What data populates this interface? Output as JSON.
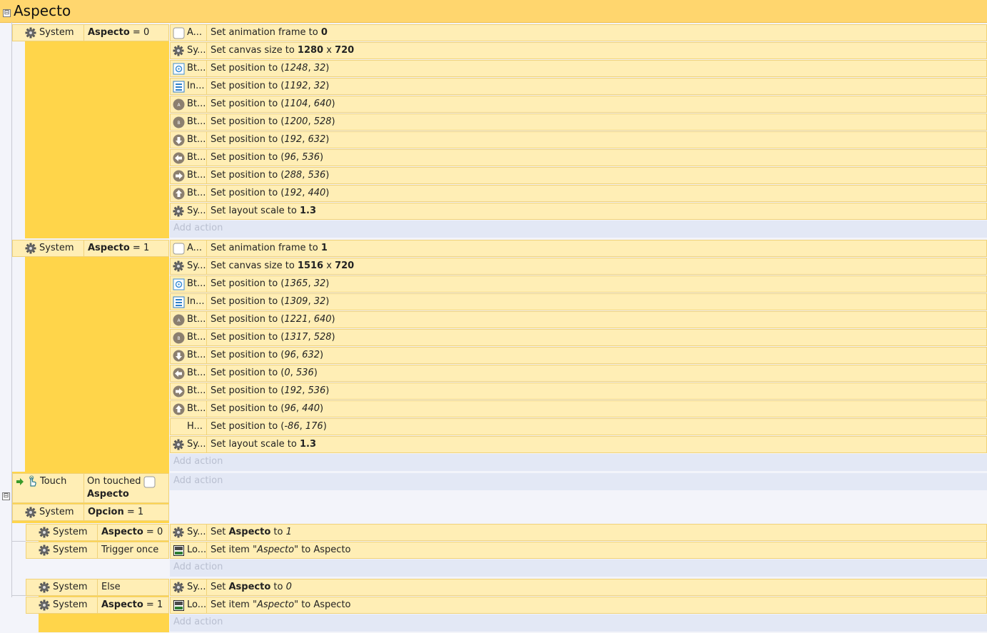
{
  "group": {
    "title": "Aspecto",
    "collapse_symbol": "⊟"
  },
  "add_action_label": "Add action",
  "events": [
    {
      "conditions": [
        {
          "object": "System",
          "icon": "gear-icon",
          "text_bold": "Aspecto",
          "text_rest": " = 0"
        }
      ],
      "actions": [
        {
          "icon": "checkbox-sprite-icon",
          "obj": "A...",
          "parts": [
            "Set animation frame to ",
            "0"
          ],
          "fmt": [
            "",
            "b"
          ]
        },
        {
          "icon": "gear-icon",
          "obj": "Sy...",
          "parts": [
            "Set canvas size to ",
            "1280",
            " x ",
            "720"
          ],
          "fmt": [
            "",
            "b",
            "",
            "b"
          ]
        },
        {
          "icon": "settings-button-icon",
          "obj": "Bt...",
          "parts": [
            "Set position to (",
            "1248",
            ", ",
            "32",
            ")"
          ],
          "fmt": [
            "",
            "i",
            "",
            "i",
            ""
          ]
        },
        {
          "icon": "list-icon",
          "obj": "In...",
          "parts": [
            "Set position to (",
            "1192",
            ", ",
            "32",
            ")"
          ],
          "fmt": [
            "",
            "i",
            "",
            "i",
            ""
          ]
        },
        {
          "icon": "button-a-icon",
          "obj": "Bt...",
          "parts": [
            "Set position to (",
            "1104",
            ", ",
            "640",
            ")"
          ],
          "fmt": [
            "",
            "i",
            "",
            "i",
            ""
          ]
        },
        {
          "icon": "button-b-icon",
          "obj": "Bt...",
          "parts": [
            "Set position to (",
            "1200",
            ", ",
            "528",
            ")"
          ],
          "fmt": [
            "",
            "i",
            "",
            "i",
            ""
          ]
        },
        {
          "icon": "arrow-down-icon",
          "obj": "Bt...",
          "parts": [
            "Set position to (",
            "192",
            ", ",
            "632",
            ")"
          ],
          "fmt": [
            "",
            "i",
            "",
            "i",
            ""
          ]
        },
        {
          "icon": "arrow-left-icon",
          "obj": "Bt...",
          "parts": [
            "Set position to (",
            "96",
            ", ",
            "536",
            ")"
          ],
          "fmt": [
            "",
            "i",
            "",
            "i",
            ""
          ]
        },
        {
          "icon": "arrow-right-icon",
          "obj": "Bt...",
          "parts": [
            "Set position to (",
            "288",
            ", ",
            "536",
            ")"
          ],
          "fmt": [
            "",
            "i",
            "",
            "i",
            ""
          ]
        },
        {
          "icon": "arrow-up-icon",
          "obj": "Bt...",
          "parts": [
            "Set position to (",
            "192",
            ", ",
            "440",
            ")"
          ],
          "fmt": [
            "",
            "i",
            "",
            "i",
            ""
          ]
        },
        {
          "icon": "gear-icon",
          "obj": "Sy...",
          "parts": [
            "Set layout scale to ",
            "1.3"
          ],
          "fmt": [
            "",
            "b"
          ]
        }
      ]
    },
    {
      "conditions": [
        {
          "object": "System",
          "icon": "gear-icon",
          "text_bold": "Aspecto",
          "text_rest": " = 1"
        }
      ],
      "actions": [
        {
          "icon": "checkbox-sprite-icon",
          "obj": "A...",
          "parts": [
            "Set animation frame to ",
            "1"
          ],
          "fmt": [
            "",
            "b"
          ]
        },
        {
          "icon": "gear-icon",
          "obj": "Sy...",
          "parts": [
            "Set canvas size to ",
            "1516",
            " x ",
            "720"
          ],
          "fmt": [
            "",
            "b",
            "",
            "b"
          ]
        },
        {
          "icon": "settings-button-icon",
          "obj": "Bt...",
          "parts": [
            "Set position to (",
            "1365",
            ", ",
            "32",
            ")"
          ],
          "fmt": [
            "",
            "i",
            "",
            "i",
            ""
          ]
        },
        {
          "icon": "list-icon",
          "obj": "In...",
          "parts": [
            "Set position to (",
            "1309",
            ", ",
            "32",
            ")"
          ],
          "fmt": [
            "",
            "i",
            "",
            "i",
            ""
          ]
        },
        {
          "icon": "button-a-icon",
          "obj": "Bt...",
          "parts": [
            "Set position to (",
            "1221",
            ", ",
            "640",
            ")"
          ],
          "fmt": [
            "",
            "i",
            "",
            "i",
            ""
          ]
        },
        {
          "icon": "button-b-icon",
          "obj": "Bt...",
          "parts": [
            "Set position to (",
            "1317",
            ", ",
            "528",
            ")"
          ],
          "fmt": [
            "",
            "i",
            "",
            "i",
            ""
          ]
        },
        {
          "icon": "arrow-down-icon",
          "obj": "Bt...",
          "parts": [
            "Set position to (",
            "96",
            ", ",
            "632",
            ")"
          ],
          "fmt": [
            "",
            "i",
            "",
            "i",
            ""
          ]
        },
        {
          "icon": "arrow-left-icon",
          "obj": "Bt...",
          "parts": [
            "Set position to (",
            "0",
            ", ",
            "536",
            ")"
          ],
          "fmt": [
            "",
            "i",
            "",
            "i",
            ""
          ]
        },
        {
          "icon": "arrow-right-icon",
          "obj": "Bt...",
          "parts": [
            "Set position to (",
            "192",
            ", ",
            "536",
            ")"
          ],
          "fmt": [
            "",
            "i",
            "",
            "i",
            ""
          ]
        },
        {
          "icon": "arrow-up-icon",
          "obj": "Bt...",
          "parts": [
            "Set position to (",
            "96",
            ", ",
            "440",
            ")"
          ],
          "fmt": [
            "",
            "i",
            "",
            "i",
            ""
          ]
        },
        {
          "icon": "none",
          "obj": "H...",
          "parts": [
            "Set position to (",
            "-86",
            ", ",
            "176",
            ")"
          ],
          "fmt": [
            "",
            "i",
            "",
            "i",
            ""
          ]
        },
        {
          "icon": "gear-icon",
          "obj": "Sy...",
          "parts": [
            "Set layout scale to ",
            "1.3"
          ],
          "fmt": [
            "",
            "b"
          ]
        }
      ]
    }
  ],
  "touch_event": {
    "trigger_object": "Touch",
    "trigger_text": "On touched",
    "trigger_target": "Aspecto",
    "cond2_object": "System",
    "cond2_bold": "Opcion",
    "cond2_rest": " = 1"
  },
  "sub_events": [
    {
      "conditions": [
        {
          "object": "System",
          "parts": [
            "Aspecto",
            " = 0"
          ],
          "fmt": [
            "b",
            ""
          ]
        },
        {
          "object": "System",
          "parts": [
            "Trigger once"
          ],
          "fmt": [
            ""
          ]
        }
      ],
      "actions": [
        {
          "icon": "gear-icon",
          "obj": "Sy...",
          "parts": [
            "Set ",
            "Aspecto",
            " to ",
            "1"
          ],
          "fmt": [
            "",
            "b",
            "",
            "i"
          ]
        },
        {
          "icon": "storage-icon",
          "obj": "Lo...",
          "parts": [
            "Set item ",
            "\"Aspecto\"",
            " to Aspecto"
          ],
          "fmt": [
            "",
            "i",
            ""
          ]
        }
      ]
    },
    {
      "conditions": [
        {
          "object": "System",
          "parts": [
            "Else"
          ],
          "fmt": [
            ""
          ]
        },
        {
          "object": "System",
          "parts": [
            "Aspecto",
            " = 1"
          ],
          "fmt": [
            "b",
            ""
          ]
        }
      ],
      "actions": [
        {
          "icon": "gear-icon",
          "obj": "Sy...",
          "parts": [
            "Set ",
            "Aspecto",
            " to ",
            "0"
          ],
          "fmt": [
            "",
            "b",
            "",
            "i"
          ]
        },
        {
          "icon": "storage-icon",
          "obj": "Lo...",
          "parts": [
            "Set item ",
            "\"Aspecto\"",
            " to Aspecto"
          ],
          "fmt": [
            "",
            "i",
            ""
          ]
        }
      ]
    }
  ]
}
